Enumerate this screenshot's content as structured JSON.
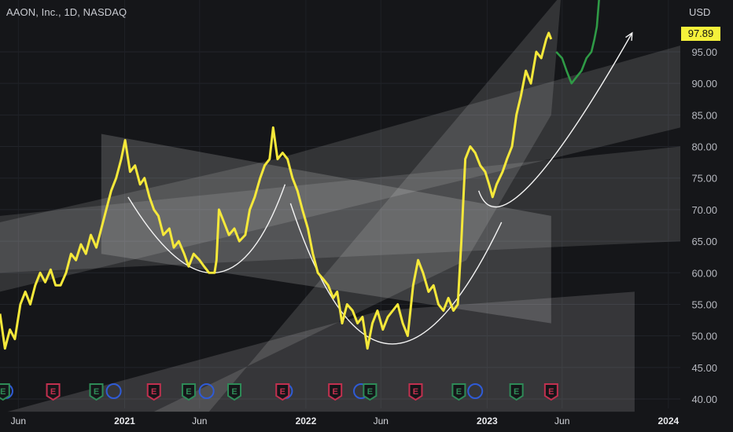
{
  "header": {
    "title": "AAON, Inc., 1D, NASDAQ"
  },
  "price_axis": {
    "unit": "USD",
    "last_price": "97.89"
  },
  "colors": {
    "price_line": "#f5e83a",
    "recent_line": "#2f9a46",
    "earnings_green": "#2e8b57",
    "earnings_red": "#c2304f",
    "dividend_blue": "#2f5bd6",
    "background": "#151619"
  },
  "chart_data": {
    "type": "line",
    "title": "AAON, Inc., 1D, NASDAQ",
    "ylabel": "USD",
    "ylim": [
      38,
      104
    ],
    "xlim": [
      "2020-04-25",
      "2024-01-25"
    ],
    "y_ticks": [
      "40.00",
      "45.00",
      "50.00",
      "55.00",
      "60.00",
      "65.00",
      "70.00",
      "75.00",
      "80.00",
      "85.00",
      "90.00",
      "95.00"
    ],
    "x_ticks": [
      {
        "date": "2020-06-01",
        "label": "Jun"
      },
      {
        "date": "2021-01-01",
        "label": "2021"
      },
      {
        "date": "2021-06-01",
        "label": "Jun"
      },
      {
        "date": "2022-01-01",
        "label": "2022"
      },
      {
        "date": "2022-06-01",
        "label": "Jun"
      },
      {
        "date": "2023-01-01",
        "label": "2023"
      },
      {
        "date": "2023-06-01",
        "label": "Jun"
      },
      {
        "date": "2024-01-01",
        "label": "2024"
      }
    ],
    "series": [
      {
        "role": "main",
        "color": "#f5e83a",
        "points": [
          [
            "2020-04-25",
            53.5
          ],
          [
            "2020-05-05",
            48
          ],
          [
            "2020-05-15",
            51
          ],
          [
            "2020-05-25",
            49.5
          ],
          [
            "2020-06-05",
            55
          ],
          [
            "2020-06-15",
            57
          ],
          [
            "2020-06-25",
            55
          ],
          [
            "2020-07-05",
            58
          ],
          [
            "2020-07-15",
            60
          ],
          [
            "2020-07-25",
            58.5
          ],
          [
            "2020-08-05",
            60.5
          ],
          [
            "2020-08-15",
            58
          ],
          [
            "2020-08-25",
            58
          ],
          [
            "2020-09-05",
            60
          ],
          [
            "2020-09-15",
            63
          ],
          [
            "2020-09-25",
            62
          ],
          [
            "2020-10-05",
            64.5
          ],
          [
            "2020-10-15",
            63
          ],
          [
            "2020-10-25",
            66
          ],
          [
            "2020-11-05",
            64
          ],
          [
            "2020-11-15",
            67
          ],
          [
            "2020-11-25",
            70
          ],
          [
            "2020-12-05",
            73
          ],
          [
            "2020-12-15",
            75
          ],
          [
            "2020-12-25",
            78
          ],
          [
            "2021-01-02",
            81
          ],
          [
            "2021-01-12",
            76
          ],
          [
            "2021-01-22",
            77
          ],
          [
            "2021-02-01",
            74
          ],
          [
            "2021-02-10",
            75
          ],
          [
            "2021-02-20",
            72
          ],
          [
            "2021-03-01",
            70
          ],
          [
            "2021-03-10",
            69
          ],
          [
            "2021-03-20",
            66
          ],
          [
            "2021-04-01",
            67
          ],
          [
            "2021-04-10",
            64
          ],
          [
            "2021-04-20",
            65
          ],
          [
            "2021-05-01",
            63
          ],
          [
            "2021-05-10",
            61
          ],
          [
            "2021-05-20",
            63
          ],
          [
            "2021-06-01",
            62
          ],
          [
            "2021-06-10",
            61
          ],
          [
            "2021-06-20",
            60
          ],
          [
            "2021-07-01",
            60
          ],
          [
            "2021-07-05",
            62
          ],
          [
            "2021-07-10",
            70
          ],
          [
            "2021-07-20",
            68
          ],
          [
            "2021-07-30",
            66
          ],
          [
            "2021-08-10",
            67
          ],
          [
            "2021-08-20",
            65
          ],
          [
            "2021-09-01",
            66
          ],
          [
            "2021-09-10",
            70
          ],
          [
            "2021-09-20",
            72
          ],
          [
            "2021-10-01",
            75
          ],
          [
            "2021-10-10",
            77
          ],
          [
            "2021-10-20",
            78
          ],
          [
            "2021-10-27",
            83
          ],
          [
            "2021-11-05",
            78
          ],
          [
            "2021-11-15",
            79
          ],
          [
            "2021-11-25",
            78
          ],
          [
            "2021-12-05",
            75
          ],
          [
            "2021-12-15",
            73
          ],
          [
            "2021-12-25",
            70
          ],
          [
            "2022-01-05",
            67
          ],
          [
            "2022-01-15",
            63
          ],
          [
            "2022-01-25",
            60
          ],
          [
            "2022-02-05",
            59
          ],
          [
            "2022-02-15",
            58
          ],
          [
            "2022-02-25",
            56
          ],
          [
            "2022-03-05",
            57
          ],
          [
            "2022-03-15",
            52
          ],
          [
            "2022-03-25",
            55
          ],
          [
            "2022-04-05",
            54
          ],
          [
            "2022-04-15",
            52
          ],
          [
            "2022-04-25",
            53
          ],
          [
            "2022-05-05",
            48
          ],
          [
            "2022-05-15",
            52
          ],
          [
            "2022-05-25",
            54
          ],
          [
            "2022-06-05",
            51
          ],
          [
            "2022-06-15",
            53
          ],
          [
            "2022-06-25",
            54
          ],
          [
            "2022-07-05",
            55
          ],
          [
            "2022-07-15",
            52
          ],
          [
            "2022-07-25",
            50
          ],
          [
            "2022-08-05",
            58
          ],
          [
            "2022-08-15",
            62
          ],
          [
            "2022-08-25",
            60
          ],
          [
            "2022-09-05",
            57
          ],
          [
            "2022-09-15",
            58
          ],
          [
            "2022-09-25",
            55
          ],
          [
            "2022-10-05",
            54
          ],
          [
            "2022-10-15",
            56
          ],
          [
            "2022-10-25",
            54
          ],
          [
            "2022-11-03",
            55
          ],
          [
            "2022-11-10",
            65
          ],
          [
            "2022-11-18",
            78
          ],
          [
            "2022-11-28",
            80
          ],
          [
            "2022-12-08",
            79
          ],
          [
            "2022-12-18",
            77
          ],
          [
            "2022-12-28",
            76
          ],
          [
            "2023-01-05",
            74
          ],
          [
            "2023-01-12",
            72
          ],
          [
            "2023-01-20",
            74
          ],
          [
            "2023-02-01",
            76
          ],
          [
            "2023-02-10",
            78
          ],
          [
            "2023-02-20",
            80
          ],
          [
            "2023-03-01",
            85
          ],
          [
            "2023-03-10",
            88
          ],
          [
            "2023-03-20",
            92
          ],
          [
            "2023-03-30",
            90
          ],
          [
            "2023-04-10",
            95
          ],
          [
            "2023-04-20",
            94
          ],
          [
            "2023-04-30",
            97
          ],
          [
            "2023-05-05",
            98
          ],
          [
            "2023-05-10",
            97
          ]
        ]
      },
      {
        "role": "recent",
        "color": "#2f9a46",
        "points": [
          [
            "2023-05-20",
            95
          ],
          [
            "2023-06-01",
            94
          ],
          [
            "2023-06-10",
            92
          ],
          [
            "2023-06-20",
            90
          ],
          [
            "2023-06-30",
            91
          ],
          [
            "2023-07-10",
            92
          ],
          [
            "2023-07-20",
            94
          ],
          [
            "2023-07-30",
            95
          ],
          [
            "2023-08-05",
            97
          ],
          [
            "2023-08-10",
            99
          ],
          [
            "2023-08-15",
            104
          ]
        ]
      }
    ],
    "annotations": {
      "arcs": [
        {
          "start": [
            "2021-01-08",
            72
          ],
          "control": [
            "2021-07-20",
            47
          ],
          "end": [
            "2021-11-20",
            74
          ]
        },
        {
          "start": [
            "2021-12-01",
            71
          ],
          "control": [
            "2022-06-01",
            28
          ],
          "end": [
            "2023-01-30",
            68
          ]
        },
        {
          "start": [
            "2022-12-15",
            73
          ],
          "control": [
            "2023-02-01",
            62
          ],
          "end": [
            "2023-10-20",
            98
          ]
        }
      ],
      "bands": [
        {
          "corners": [
            [
              "2020-05-10",
              38
            ],
            [
              "2023-10-25",
              38
            ],
            [
              "2023-10-25",
              57
            ],
            [
              "2022-06-01",
              54
            ]
          ]
        },
        {
          "corners": [
            [
              "2020-04-25",
              68
            ],
            [
              "2021-11-01",
              78
            ],
            [
              "2024-01-25",
              96
            ],
            [
              "2024-01-25",
              83
            ],
            [
              "2020-04-25",
              57
            ]
          ]
        },
        {
          "corners": [
            [
              "2020-04-25",
              60
            ],
            [
              "2024-01-25",
              65
            ],
            [
              "2024-01-25",
              80
            ],
            [
              "2020-04-25",
              69
            ]
          ]
        },
        {
          "corners": [
            [
              "2020-11-15",
              82
            ],
            [
              "2023-05-10",
              69
            ],
            [
              "2023-05-10",
              52
            ],
            [
              "2020-11-15",
              63
            ]
          ]
        },
        {
          "corners": [
            [
              "2021-06-20",
              38
            ],
            [
              "2023-05-30",
              104
            ],
            [
              "2023-05-30",
              104
            ],
            [
              "2023-05-10",
              85
            ],
            [
              "2022-11-20",
              62
            ],
            [
              "2021-03-01",
              38
            ]
          ]
        }
      ],
      "dividend_dots": [
        "2020-05-06",
        "2020-12-10",
        "2021-06-15",
        "2021-11-20",
        "2022-04-22",
        "2022-12-08"
      ]
    },
    "events": [
      {
        "date": "2020-05-01",
        "type": "earnings",
        "sign": "positive",
        "label": "E"
      },
      {
        "date": "2020-08-10",
        "type": "earnings",
        "sign": "negative",
        "label": "E"
      },
      {
        "date": "2020-11-05",
        "type": "earnings",
        "sign": "positive",
        "label": "E"
      },
      {
        "date": "2021-03-01",
        "type": "earnings",
        "sign": "negative",
        "label": "E"
      },
      {
        "date": "2021-05-10",
        "type": "earnings",
        "sign": "positive",
        "label": "E"
      },
      {
        "date": "2021-08-10",
        "type": "earnings",
        "sign": "positive",
        "label": "E"
      },
      {
        "date": "2021-11-15",
        "type": "earnings",
        "sign": "negative",
        "label": "E"
      },
      {
        "date": "2022-03-01",
        "type": "earnings",
        "sign": "negative",
        "label": "E"
      },
      {
        "date": "2022-05-10",
        "type": "earnings",
        "sign": "positive",
        "label": "E"
      },
      {
        "date": "2022-08-10",
        "type": "earnings",
        "sign": "negative",
        "label": "E"
      },
      {
        "date": "2022-11-05",
        "type": "earnings",
        "sign": "positive",
        "label": "E"
      },
      {
        "date": "2023-03-01",
        "type": "earnings",
        "sign": "positive",
        "label": "E"
      },
      {
        "date": "2023-05-10",
        "type": "earnings",
        "sign": "negative",
        "label": "E"
      }
    ]
  }
}
